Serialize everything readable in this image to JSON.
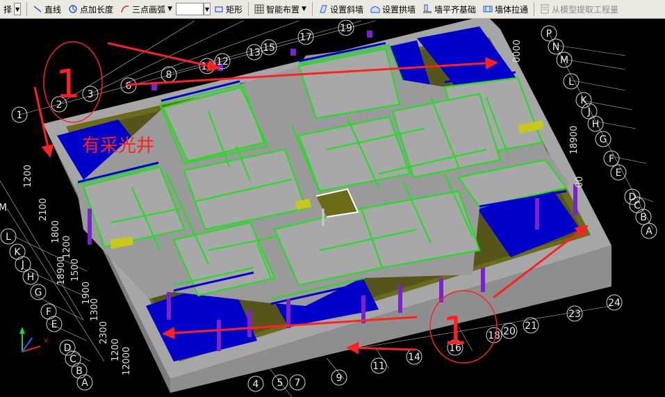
{
  "toolbar": {
    "partial_left": "择",
    "line": "直线",
    "point_length": "点加长度",
    "three_point_arc": "三点画弧",
    "rect": "矩形",
    "smart_layout": "智能布置",
    "set_sloped_wall": "设置斜墙",
    "set_arch_wall": "设置拱墙",
    "wall_align_foundation": "墙平齐基础",
    "wall_stretch": "墙体拉通",
    "extract_from_model": "从模型提取工程量"
  },
  "viewport": {
    "annotation_text": "有采光井",
    "annotation_number": "1",
    "top_axis_labels": [
      "1",
      "2",
      "3",
      "6",
      "8",
      "10",
      "12",
      "13",
      "15",
      "17",
      "19"
    ],
    "right_axis_letters": [
      "P",
      "N",
      "M",
      "L",
      "K",
      "J",
      "H",
      "G",
      "F",
      "E",
      "D",
      "C",
      "B",
      "A"
    ],
    "left_axis_letters": [
      "M",
      "L",
      "K",
      "J",
      "H",
      "G",
      "F",
      "E",
      "D",
      "C",
      "B",
      "A"
    ],
    "bottom_axis_labels": [
      "4",
      "5",
      "7",
      "9",
      "11",
      "14",
      "16",
      "18",
      "20",
      "21",
      "23",
      "24"
    ],
    "right_dims": [
      "18900",
      "0000",
      "00"
    ],
    "left_dims": [
      "1200",
      "2100",
      "1800",
      "1200",
      "1500",
      "18900",
      "1900",
      "1300",
      "2300",
      "1200",
      "12000"
    ],
    "colors": {
      "slab": "#9a9a9a",
      "wall": "#8e8e8e",
      "beam": "#22dd22",
      "room": "#0000c8",
      "column": "#7a22cc",
      "annotation": "#ff2020",
      "grid": "#c8c8c8"
    }
  }
}
